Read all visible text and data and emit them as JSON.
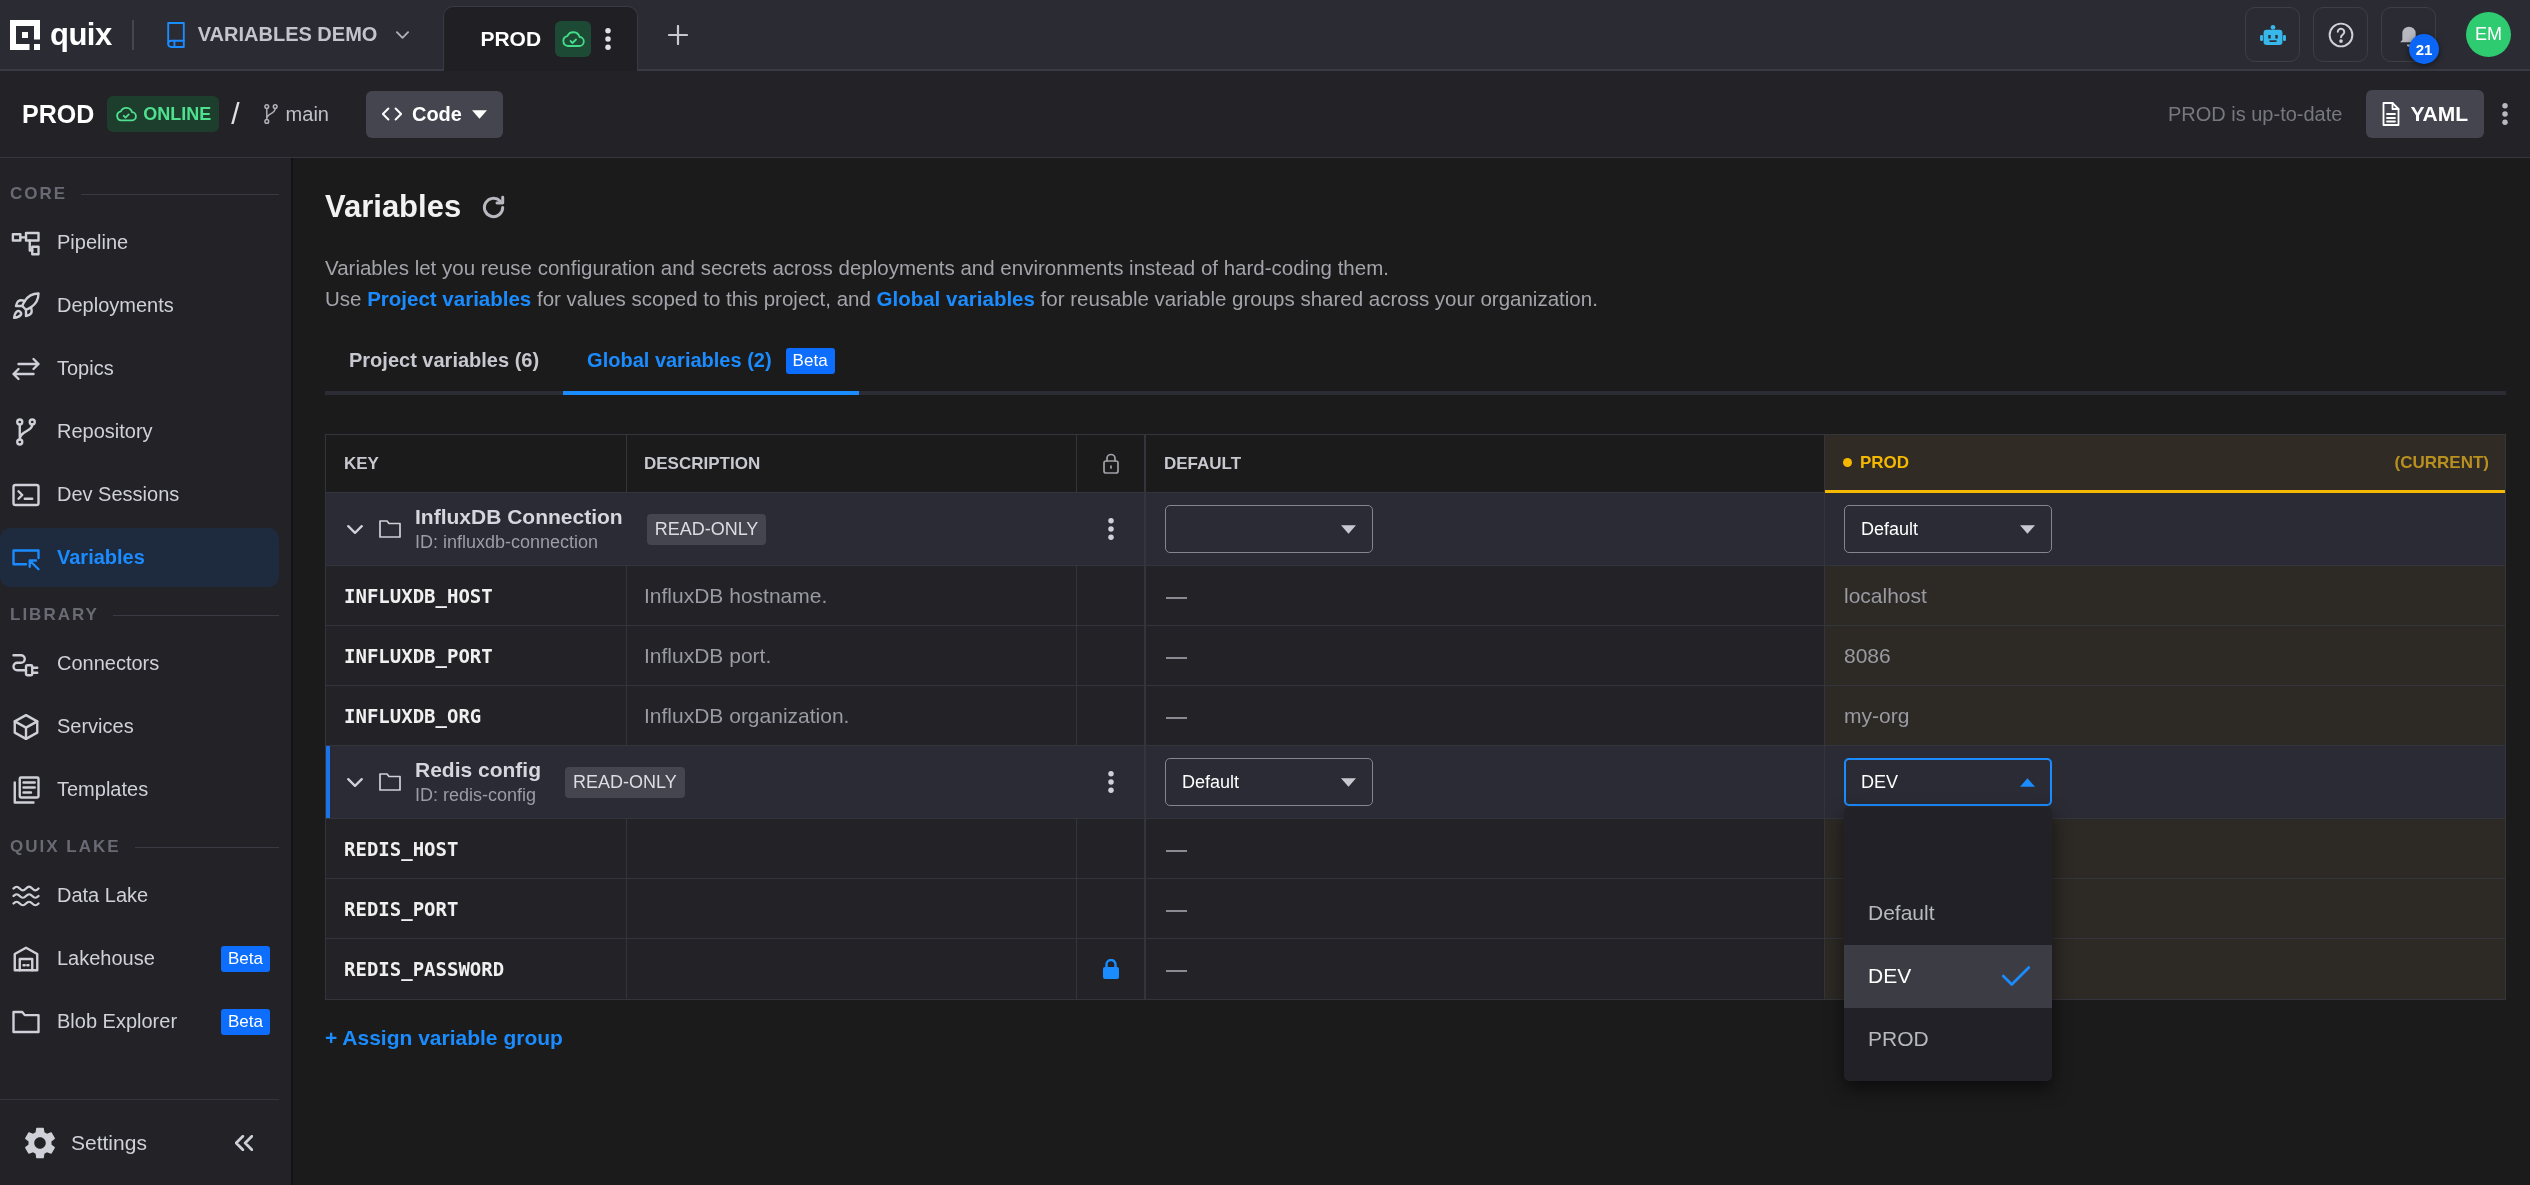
{
  "top_bar": {
    "logo": "quix",
    "project": "VARIABLES DEMO",
    "tabs": [
      {
        "label": "PROD",
        "selected": true
      }
    ],
    "notification_count": "21",
    "avatar": "EM"
  },
  "env_bar": {
    "environment": "PROD",
    "status": "ONLINE",
    "separator": "/",
    "branch": "main",
    "code_button": "Code",
    "sync_status": "PROD is up-to-date",
    "yaml_button": "YAML"
  },
  "sidebar": {
    "sections": [
      {
        "title": "CORE",
        "items": [
          {
            "label": "Pipeline",
            "selected": false
          },
          {
            "label": "Deployments",
            "selected": false
          },
          {
            "label": "Topics",
            "selected": false
          },
          {
            "label": "Repository",
            "selected": false
          },
          {
            "label": "Dev Sessions",
            "selected": false
          },
          {
            "label": "Variables",
            "selected": true
          }
        ]
      },
      {
        "title": "LIBRARY",
        "items": [
          {
            "label": "Connectors",
            "selected": false
          },
          {
            "label": "Services",
            "selected": false
          },
          {
            "label": "Templates",
            "selected": false
          }
        ]
      },
      {
        "title": "QUIX LAKE",
        "items": [
          {
            "label": "Data Lake",
            "selected": false
          },
          {
            "label": "Lakehouse",
            "selected": false,
            "badge": "Beta"
          },
          {
            "label": "Blob Explorer",
            "selected": false,
            "badge": "Beta"
          }
        ]
      }
    ],
    "settings": "Settings"
  },
  "page": {
    "title": "Variables",
    "description": [
      [
        {
          "kind": "text",
          "text": "Variables let you reuse configuration and secrets across deployments and environments instead of hard-coding them."
        }
      ],
      [
        {
          "kind": "text",
          "text": "Use "
        },
        {
          "kind": "link",
          "text": "Project variables"
        },
        {
          "kind": "text",
          "text": " for values scoped to this project, and "
        },
        {
          "kind": "link",
          "text": "Global variables"
        },
        {
          "kind": "text",
          "text": " for reusable variable groups shared across your organization."
        }
      ]
    ],
    "tabs": [
      {
        "label": "Project variables (6)",
        "selected": false
      },
      {
        "label": "Global variables (2)",
        "badge": "Beta",
        "selected": true
      }
    ]
  },
  "table": {
    "columns": {
      "key": "KEY",
      "description": "DESCRIPTION",
      "default": "DEFAULT",
      "environment": "PROD",
      "environment_note": "(CURRENT)"
    },
    "groups": [
      {
        "name": "InfluxDB Connection",
        "id": "ID: influxdb-connection",
        "badge": "READ-ONLY",
        "selected": false,
        "expanded": true,
        "default_select": {
          "open": false
        },
        "environment_select": {
          "value": "Default",
          "open": false
        },
        "variables": [
          {
            "key": "INFLUXDB_HOST",
            "description": "InfluxDB hostname.",
            "secret": false,
            "default": "—",
            "value": "localhost"
          },
          {
            "key": "INFLUXDB_PORT",
            "description": "InfluxDB port.",
            "secret": false,
            "default": "—",
            "value": "8086"
          },
          {
            "key": "INFLUXDB_ORG",
            "description": "InfluxDB organization.",
            "secret": false,
            "default": "—",
            "value": "my-org"
          }
        ]
      },
      {
        "name": "Redis config",
        "id": "ID: redis-config",
        "badge": "READ-ONLY",
        "selected": true,
        "expanded": true,
        "default_select": {
          "value": "Default",
          "open": false
        },
        "environment_select": {
          "value": "DEV",
          "open": true,
          "options": [
            {
              "label": "Default",
              "selected": false
            },
            {
              "label": "DEV",
              "selected": true
            },
            {
              "label": "PROD",
              "selected": false
            }
          ]
        },
        "variables": [
          {
            "key": "REDIS_HOST",
            "secret": false,
            "default": "—"
          },
          {
            "key": "REDIS_PORT",
            "secret": false,
            "default": "—"
          },
          {
            "key": "REDIS_PASSWORD",
            "secret": true,
            "default": "—"
          }
        ]
      }
    ]
  },
  "assign_link": "+ Assign variable group"
}
